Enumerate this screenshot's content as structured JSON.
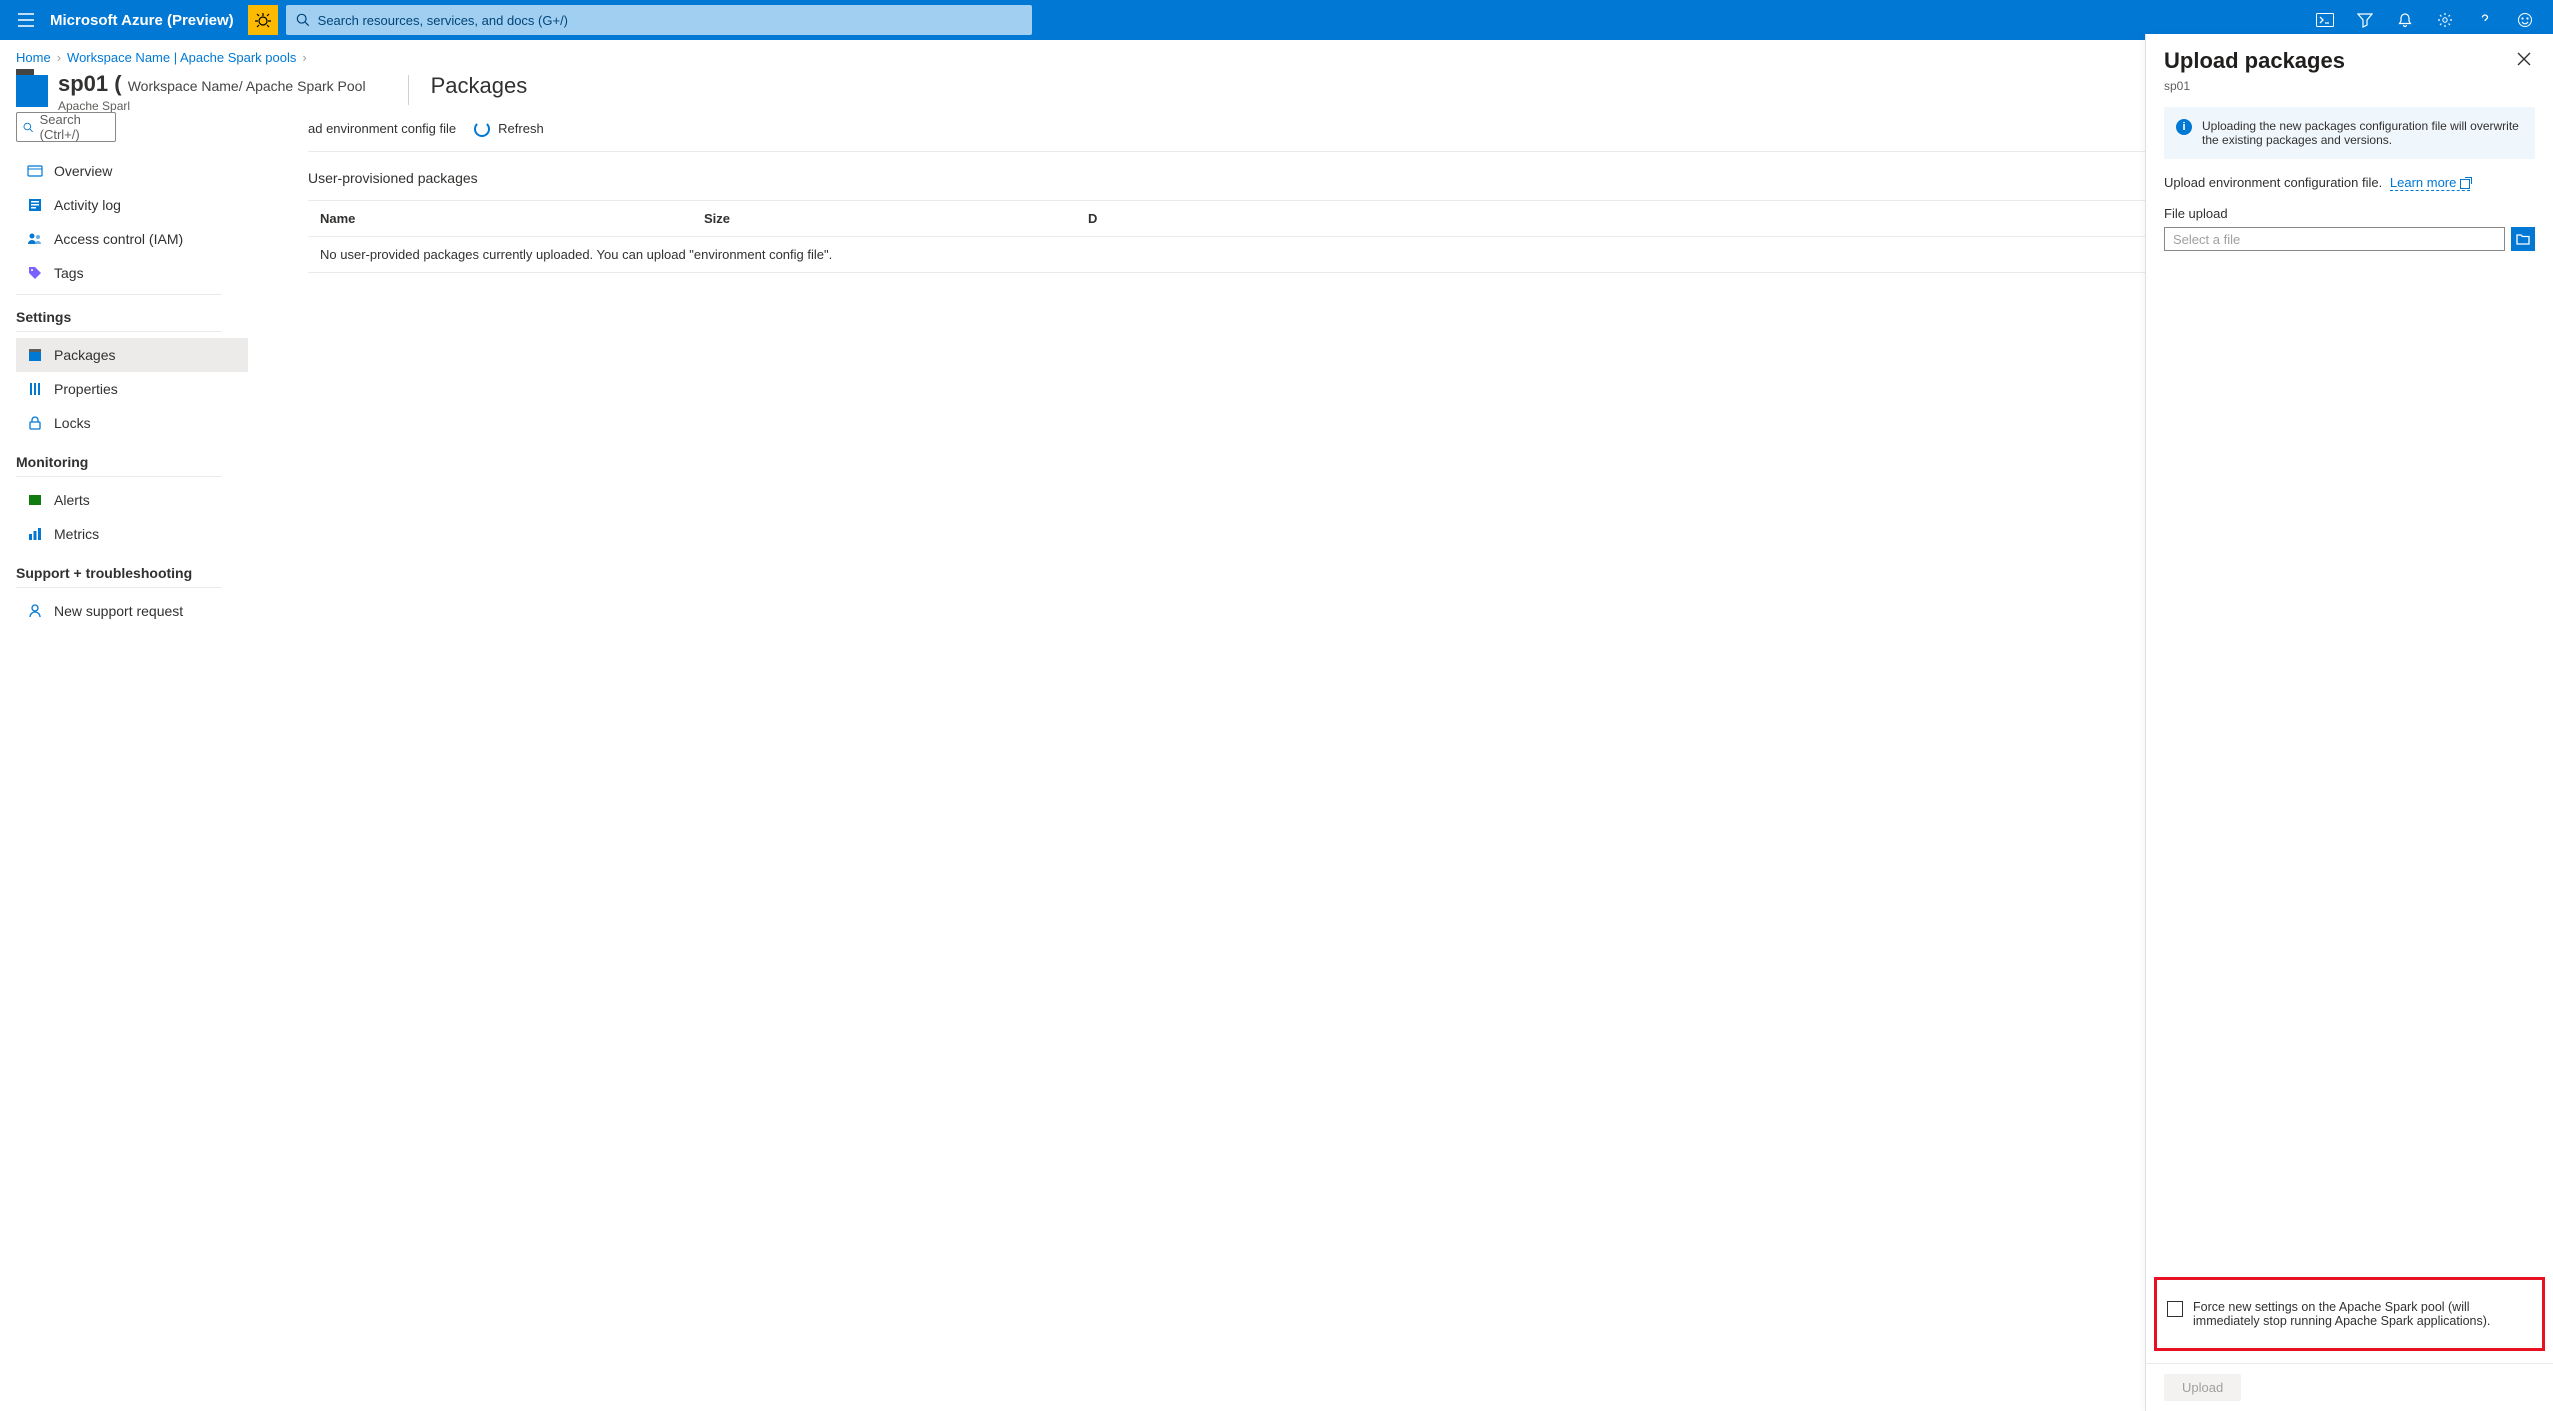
{
  "topbar": {
    "brand": "Microsoft Azure (Preview)",
    "search_placeholder": "Search resources, services, and docs (G+/)"
  },
  "breadcrumb": {
    "items": [
      "Home",
      "Workspace Name | Apache Spark pools"
    ]
  },
  "resource": {
    "name": "sp01 (",
    "context": "Workspace Name/ Apache Spark Pool",
    "type": "Apache Sparl",
    "section": "Packages"
  },
  "sidebar": {
    "search_placeholder": "Search (Ctrl+/)",
    "top": [
      {
        "label": "Overview",
        "icon": "overview-icon"
      },
      {
        "label": "Activity log",
        "icon": "activity-log-icon"
      },
      {
        "label": "Access control (IAM)",
        "icon": "access-control-icon"
      },
      {
        "label": "Tags",
        "icon": "tags-icon"
      }
    ],
    "groups": [
      {
        "title": "Settings",
        "items": [
          {
            "label": "Packages",
            "icon": "packages-icon",
            "active": true
          },
          {
            "label": "Properties",
            "icon": "properties-icon"
          },
          {
            "label": "Locks",
            "icon": "locks-icon"
          }
        ]
      },
      {
        "title": "Monitoring",
        "items": [
          {
            "label": "Alerts",
            "icon": "alerts-icon"
          },
          {
            "label": "Metrics",
            "icon": "metrics-icon"
          }
        ]
      },
      {
        "title": "Support + troubleshooting",
        "items": [
          {
            "label": "New support request",
            "icon": "support-icon"
          }
        ]
      }
    ]
  },
  "toolbar": {
    "frag": "ad environment config file",
    "refresh": "Refresh"
  },
  "packages": {
    "heading": "User-provisioned packages",
    "columns": {
      "name": "Name",
      "size": "Size",
      "date": "D"
    },
    "empty": "No user-provided packages currently uploaded. You can upload \"environment config file\"."
  },
  "panel": {
    "title": "Upload packages",
    "sub": "sp01",
    "info": "Uploading the new packages configuration file will overwrite the existing packages and versions.",
    "desc": "Upload environment configuration file.",
    "learn_more": "Learn more",
    "file_label": "File upload",
    "file_placeholder": "Select a file",
    "force_label": "Force new settings on the Apache Spark pool (will immediately stop running Apache Spark applications).",
    "upload": "Upload"
  }
}
